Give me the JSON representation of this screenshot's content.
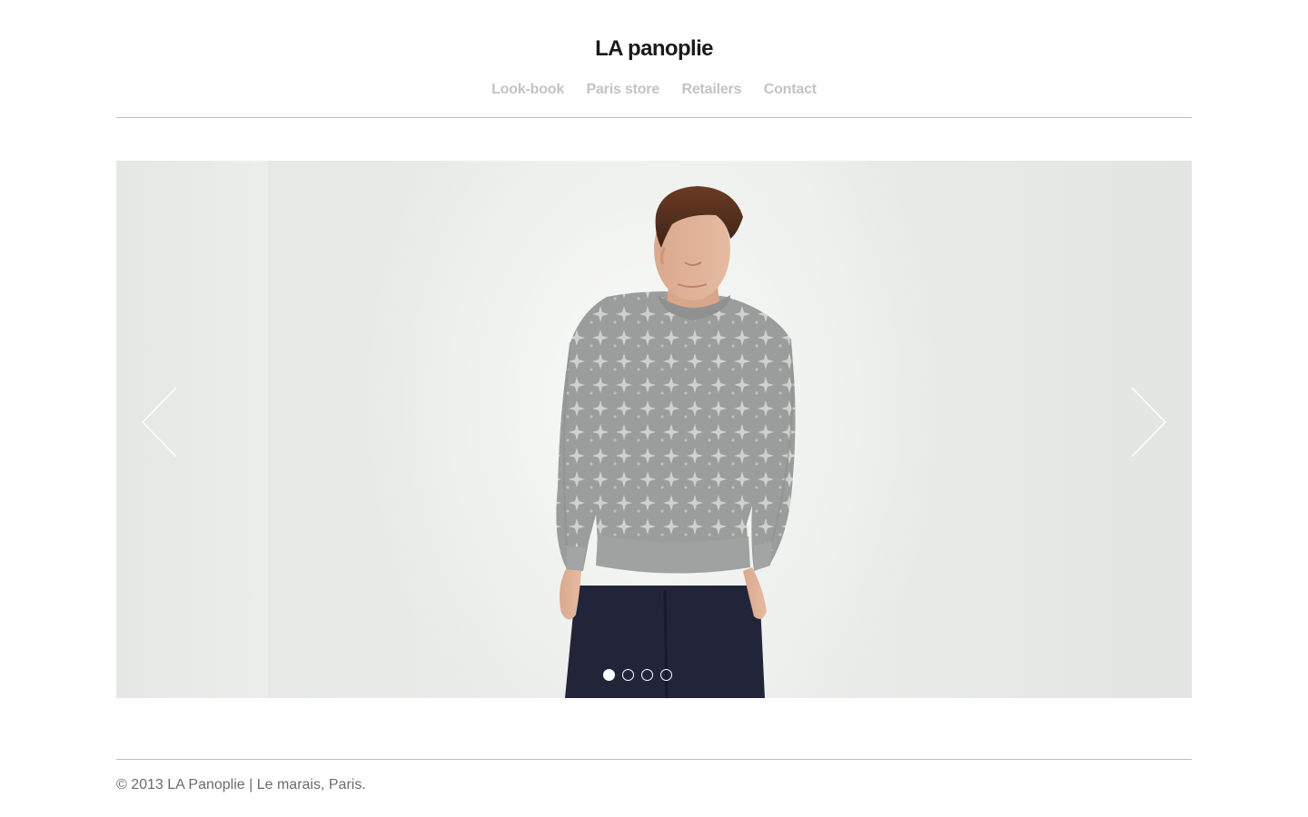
{
  "header": {
    "site_title": "LA panoplie",
    "nav": [
      {
        "label": "Look-book"
      },
      {
        "label": "Paris store"
      },
      {
        "label": "Retailers"
      },
      {
        "label": "Contact"
      }
    ]
  },
  "slider": {
    "prev_icon": "chevron-left-icon",
    "next_icon": "chevron-right-icon",
    "image_alt": "Model wearing grey patterned sweatshirt and navy trousers",
    "slide_count": 4,
    "active_slide": 1
  },
  "footer": {
    "text": "© 2013 LA Panoplie | Le marais, Paris."
  },
  "colors": {
    "title": "#1a1a1a",
    "nav": "#c3c3c3",
    "rule": "#bdbdbd",
    "footer_text": "#6b6b6b",
    "slide_bg": "#e9ece8"
  }
}
